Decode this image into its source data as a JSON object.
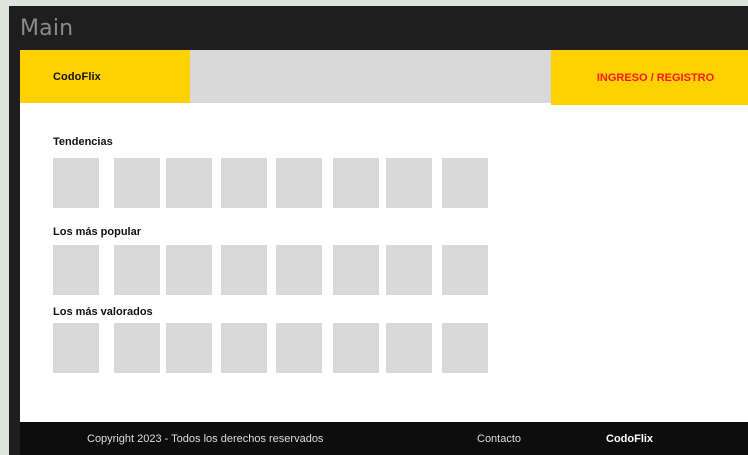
{
  "frame": {
    "label": "Main"
  },
  "header": {
    "brand": "CodoFlix",
    "login": "INGRESO / REGISTRO"
  },
  "sections": [
    {
      "title": "Tendencias",
      "tiles": 8
    },
    {
      "title": "Los más popular",
      "tiles": 8
    },
    {
      "title": "Los más valorados",
      "tiles": 8
    }
  ],
  "footer": {
    "copyright": "Copyright 2023 - Todos los derechos reservados",
    "contact": "Contacto",
    "brand": "CodoFlix"
  },
  "colors": {
    "accent": "#ffd100",
    "login_text": "#ff1a1a",
    "placeholder": "#d9d9d9",
    "footer_bg": "#0d0d0d"
  }
}
